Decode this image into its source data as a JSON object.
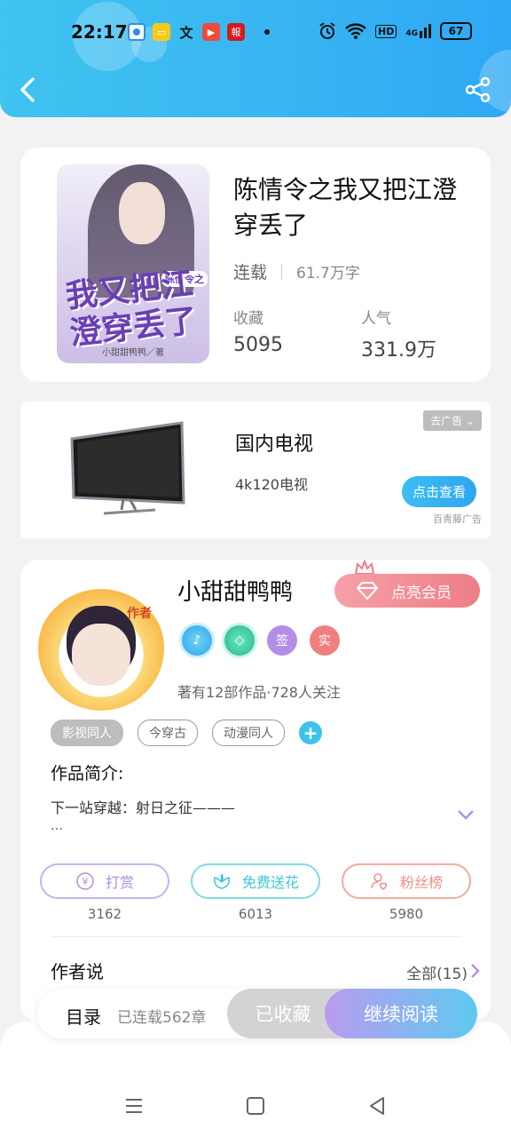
{
  "status": {
    "time": "22:17",
    "network": "4G",
    "hd": "HD",
    "battery": "67"
  },
  "header": {
    "back_icon": "back-arrow-icon",
    "share_icon": "share-icon"
  },
  "book": {
    "cover_title": "我又把江澄穿丢了",
    "cover_series": "陈情令之",
    "cover_author": "小甜甜鸭鸭／著",
    "title": "陈情令之我又把江澄穿丢了",
    "status": "连载",
    "words": "61.7万字",
    "fav_label": "收藏",
    "fav_value": "5095",
    "pop_label": "人气",
    "pop_value": "331.9万"
  },
  "ad": {
    "title": "国内电视",
    "subtitle": "4k120电视",
    "close": "去广告",
    "button": "点击查看",
    "source": "百青藤广告"
  },
  "author": {
    "avatar_tag": "作者",
    "name": "小甜甜鸭鸭",
    "vip_button": "点亮会员",
    "badges": [
      "签",
      "实"
    ],
    "meta": "著有12部作品·728人关注",
    "tags": [
      "影视同人",
      "今穿古",
      "动漫同人"
    ],
    "intro_heading": "作品简介:",
    "intro_text": "下一站穿越：射日之征———",
    "intro_more": "…",
    "actions": [
      {
        "label": "打赏",
        "count": "3162",
        "icon": "yuan-coin-icon",
        "color": "#b08ee0"
      },
      {
        "label": "免费送花",
        "count": "6013",
        "icon": "flower-icon",
        "color": "#3cc8d6"
      },
      {
        "label": "粉丝榜",
        "count": "5980",
        "icon": "fans-icon",
        "color": "#ef8f86"
      }
    ],
    "says_heading": "作者说",
    "says_all": "全部(15)"
  },
  "bottom": {
    "toc": "目录",
    "chapters": "已连载562章",
    "favorited": "已收藏",
    "continue": "继续阅读"
  },
  "colors": {
    "header": "#37b4f2",
    "vip": "#ee7d86",
    "accent_purple": "#b99bf0"
  }
}
